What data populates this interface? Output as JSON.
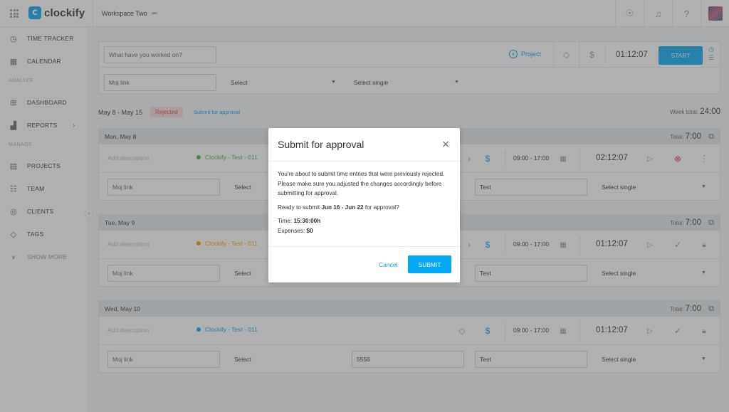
{
  "app": {
    "name": "clockify",
    "workspace": "Workspace Two"
  },
  "sidebar": {
    "items": [
      {
        "label": "TIME TRACKER",
        "icon": "clock-icon"
      },
      {
        "label": "CALENDAR",
        "icon": "calendar-icon"
      },
      {
        "label": "DASHBOARD",
        "icon": "dashboard-icon"
      },
      {
        "label": "REPORTS",
        "icon": "reports-icon"
      },
      {
        "label": "PROJECTS",
        "icon": "projects-icon"
      },
      {
        "label": "TEAM",
        "icon": "team-icon"
      },
      {
        "label": "CLIENTS",
        "icon": "clients-icon"
      },
      {
        "label": "TAGS",
        "icon": "tag-icon"
      },
      {
        "label": "SHOW MORE",
        "icon": "chevron-down-icon"
      }
    ],
    "sections": {
      "analyze": "ANALYZE",
      "manage": "MANAGE"
    }
  },
  "timer": {
    "description_placeholder": "What have you worked on?",
    "project_label": "Project",
    "time": "01:12:07",
    "start_label": "START",
    "custom_field_placeholder": "Moj link",
    "select_label": "Select",
    "select_single_label": "Select single"
  },
  "week": {
    "range": "May 8 - May 15",
    "status": "Rejected",
    "submit_link": "Submit for approval",
    "total_label": "Week total:",
    "total_value": "24:00"
  },
  "days": [
    {
      "title": "Mon, May 8",
      "total_label": "Total:",
      "total": "7:00",
      "description_placeholder": "Add description",
      "project": "Clockify - Test - 011",
      "project_color": "#4caf50",
      "times": "09:00 - 17:00",
      "duration": "02:12:07",
      "field1": "Moj link",
      "field2": "Select",
      "field3": "",
      "field4": "Test",
      "field5": "Select single"
    },
    {
      "title": "Tue, May 9",
      "total_label": "Total:",
      "total": "7:00",
      "description_placeholder": "Add description",
      "project": "Clockify - Test - 011",
      "project_color": "#ff9800",
      "times": "09:00 - 17:00",
      "duration": "01:12:07",
      "field1": "Moj link",
      "field2": "Select",
      "field3": "",
      "field4": "Test",
      "field5": "Select single"
    },
    {
      "title": "Wed, May 10",
      "total_label": "Total:",
      "total": "7:00",
      "description_placeholder": "Add description",
      "project": "Clockify - Test - 011",
      "project_color": "#03a9f4",
      "times": "09:00 - 17:00",
      "duration": "01:12:07",
      "field1": "Moj link",
      "field2": "Select",
      "field3": "5556",
      "field4": "Test",
      "field5": "Select single"
    }
  ],
  "modal": {
    "title": "Submit for approval",
    "message": "You're about to submit time entries that were previously rejected. Please make sure you adjusted the changes accordingly before submitting for approval.",
    "ready_prefix": "Ready to submit ",
    "ready_range": "Jun 16 - Jun 22",
    "ready_suffix": " for approval?",
    "time_label": "Time: ",
    "time_value": "15:30:00h",
    "expenses_label": "Expenses: ",
    "expenses_value": "$0",
    "cancel_label": "Cancel",
    "submit_label": "SUBMIT"
  }
}
